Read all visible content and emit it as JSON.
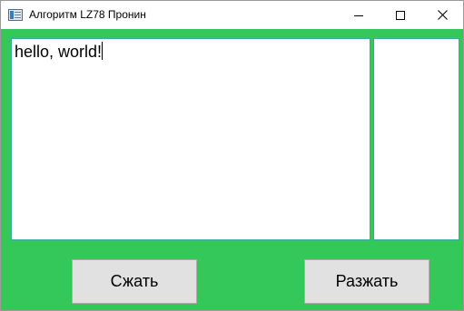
{
  "window": {
    "title": "Алгоритм LZ78 Пронин",
    "icon": "app-window-icon"
  },
  "titlebar_buttons": {
    "minimize_icon": "minimize-icon",
    "maximize_icon": "maximize-icon",
    "close_icon": "close-icon"
  },
  "editor": {
    "input_value": "hello, world!",
    "output_value": ""
  },
  "buttons": {
    "compress_label": "Сжать",
    "decompress_label": "Разжать"
  },
  "colors": {
    "client_background": "#34c759",
    "button_face": "#e1e1e1",
    "textbox_border": "#3aa9a0"
  }
}
